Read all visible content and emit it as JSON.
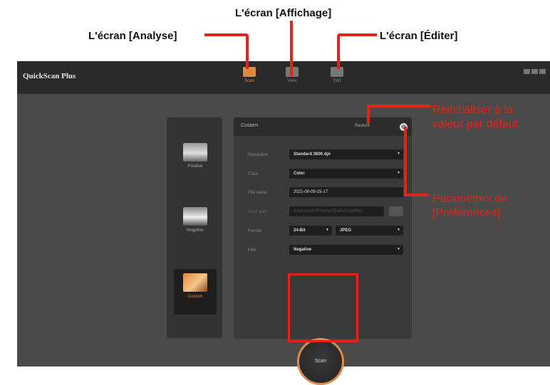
{
  "annotations": {
    "affichage": "L'écran [Affichage]",
    "analyse": "L'écran [Analyse]",
    "editer": "L'écran [Éditer]",
    "reset_line1": "Réinitialiser à la",
    "reset_line2": "valeur par défaut",
    "prefs_line1": "Paramètres de",
    "prefs_line2": "[Préférences]"
  },
  "app": {
    "title": "QuickScan Plus",
    "modes": [
      {
        "label": "Scan",
        "icon": "scan-mode-icon"
      },
      {
        "label": "View",
        "icon": "view-mode-icon"
      },
      {
        "label": "Edit",
        "icon": "edit-mode-icon"
      }
    ]
  },
  "film_types": [
    {
      "label": "Positive",
      "icon": "positive-film-icon",
      "selected": false
    },
    {
      "label": "Negative",
      "icon": "negative-film-icon",
      "selected": false
    },
    {
      "label": "Custom",
      "icon": "custom-film-icon",
      "selected": true
    }
  ],
  "settings": {
    "title": "Custom",
    "restore_label": "Restore",
    "gear_glyph": "⚙",
    "rows": {
      "resolution": {
        "label": "Resolution",
        "value": "Standard 3600 dpi"
      },
      "color": {
        "label": "Color",
        "value": "Color"
      },
      "filename": {
        "label": "File name",
        "value": "2021-08-09-15-17"
      },
      "save_path": {
        "label": "Save path",
        "value": "/Users/user/Pictures/QuickScanPlus"
      },
      "format": {
        "label": "Format",
        "bit_depth": "24-Bit",
        "file_type": "JPEG"
      },
      "film": {
        "label": "Film",
        "value": "Negative"
      }
    }
  },
  "scan_button": {
    "label": "Scan"
  },
  "colors": {
    "accent": "#e5231b",
    "app_bg": "#4a4a4a",
    "scan_ring": "#d98a4e"
  }
}
